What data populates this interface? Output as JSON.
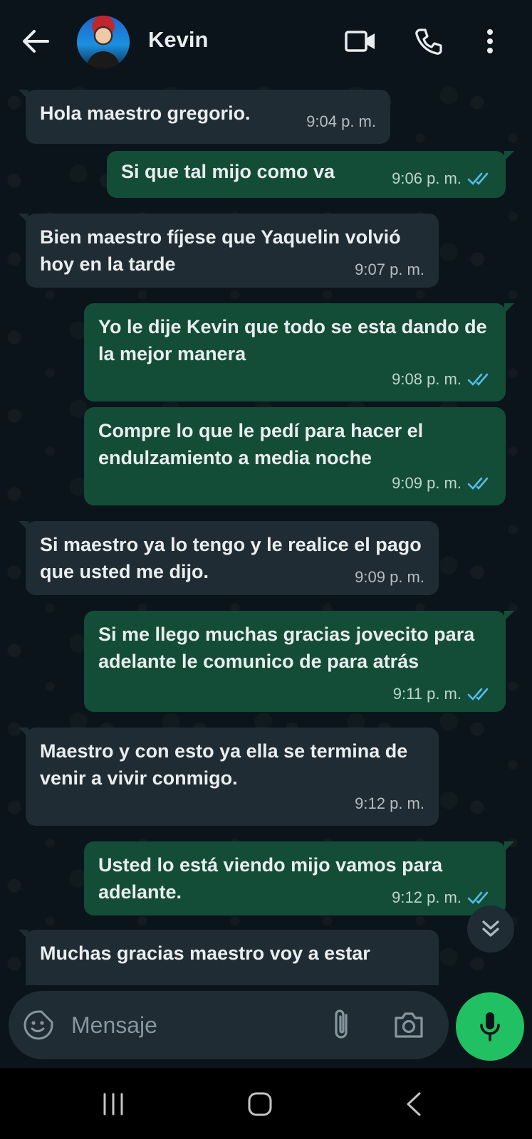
{
  "header": {
    "contact_name": "Kevin",
    "back_icon": "arrow-left-icon",
    "video_icon": "video-camera-icon",
    "call_icon": "phone-icon",
    "menu_icon": "kebab-menu-icon"
  },
  "messages": [
    {
      "dir": "in",
      "text": "Hola maestro gregorio.",
      "time": "9:04 p. m."
    },
    {
      "dir": "out",
      "text": "Si que tal mijo como va",
      "time": "9:06 p. m.",
      "read": true
    },
    {
      "dir": "in",
      "text": "Bien maestro fíjese que Yaquelin volvió hoy en la tarde",
      "time": "9:07 p. m."
    },
    {
      "dir": "out",
      "text": "Yo le dije Kevin que todo se esta dando de la mejor manera",
      "time": "9:08 p. m.",
      "read": true
    },
    {
      "dir": "out",
      "text": "Compre lo que le pedí para hacer el endulzamiento a media noche",
      "time": "9:09 p. m.",
      "read": true
    },
    {
      "dir": "in",
      "text": "Si maestro ya lo tengo y le realice el pago que usted me dijo.",
      "time": "9:09 p. m."
    },
    {
      "dir": "out",
      "text": "Si me llego muchas gracias jovecito para adelante le comunico de para atrás",
      "time": "9:11 p. m.",
      "read": true
    },
    {
      "dir": "in",
      "text": "Maestro y con esto ya ella se termina de venir a vivir conmigo.",
      "time": "9:12 p. m."
    },
    {
      "dir": "out",
      "text": "Usted lo está viendo mijo vamos para adelante.",
      "time": "9:12 p. m.",
      "read": true
    },
    {
      "dir": "in",
      "text": "Muchas gracias maestro voy a estar",
      "time": ""
    }
  ],
  "composer": {
    "placeholder": "Mensaje",
    "emoji_icon": "sticker-emoji-icon",
    "attach_icon": "paperclip-icon",
    "camera_icon": "camera-icon",
    "mic_icon": "microphone-icon"
  },
  "colors": {
    "background": "#0b141a",
    "incoming_bubble": "#202c33",
    "outgoing_bubble": "#144d37",
    "read_ticks": "#53bdeb",
    "mic_button": "#21c063"
  }
}
